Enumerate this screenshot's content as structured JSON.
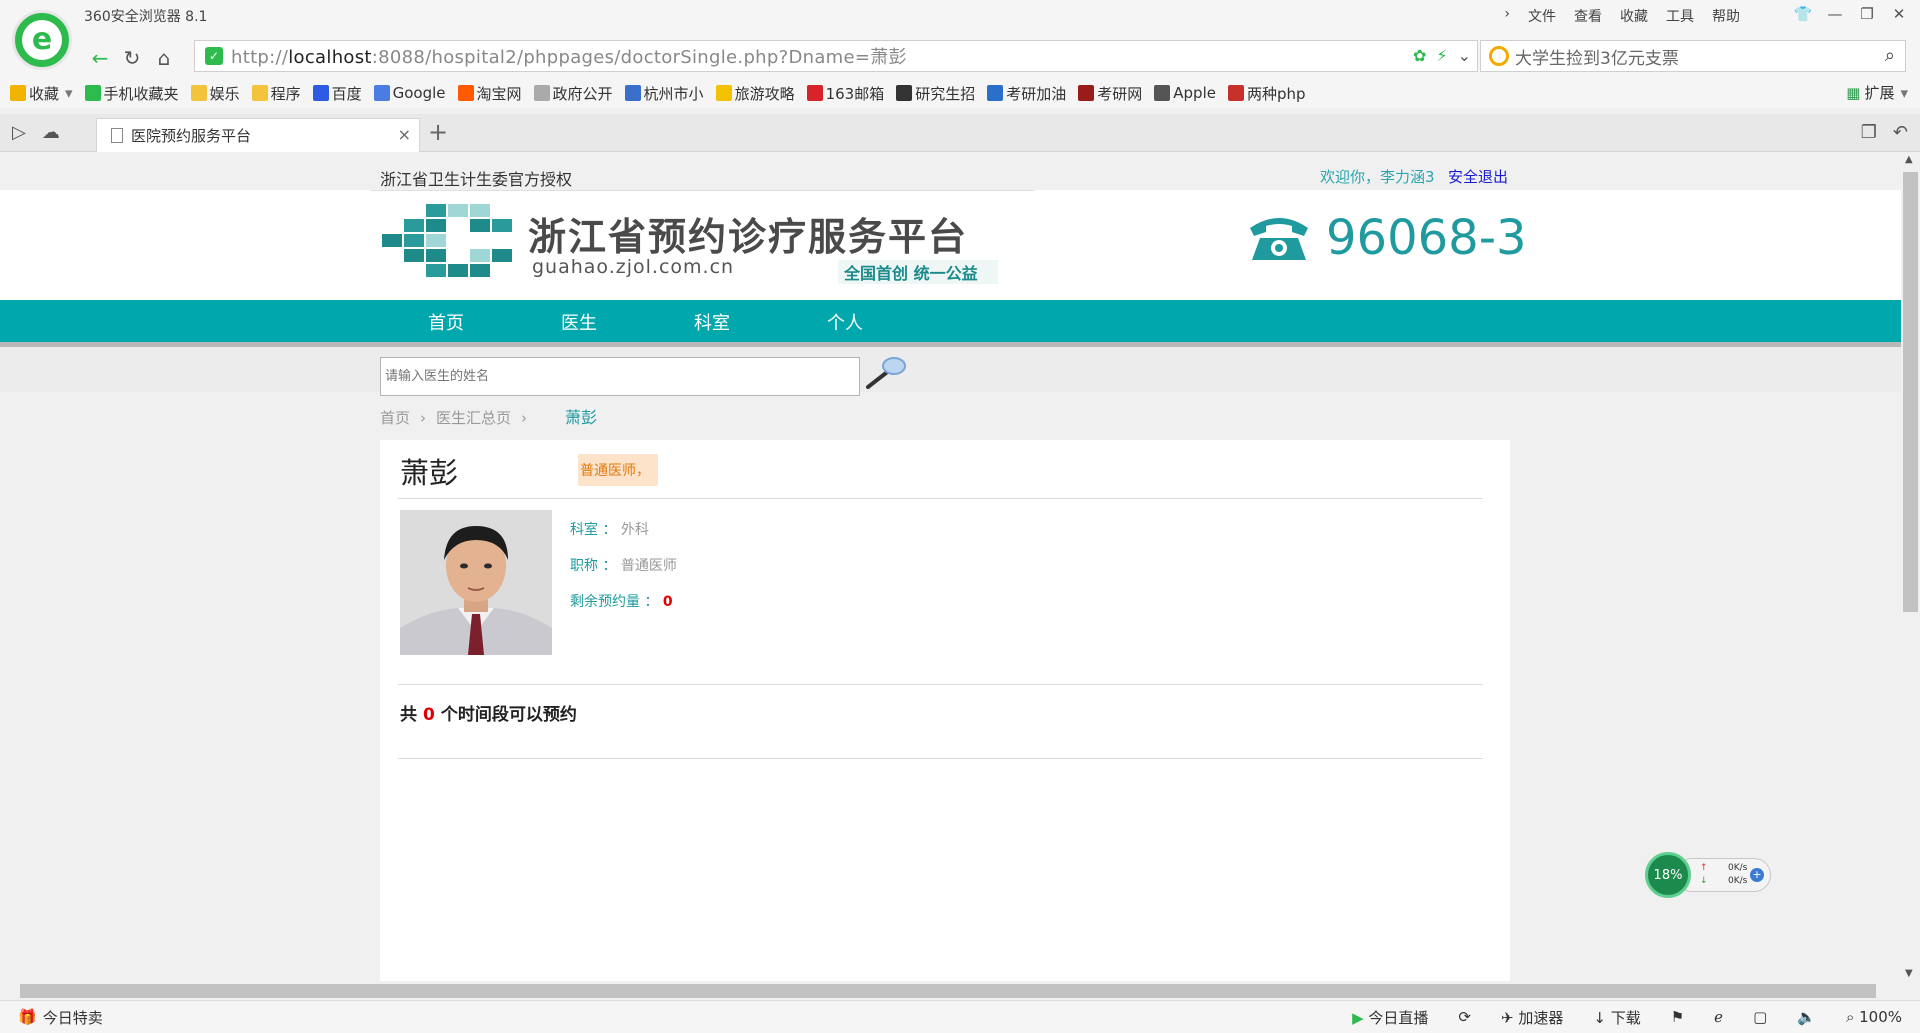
{
  "browser": {
    "app_title": "360安全浏览器 8.1",
    "menus": [
      "文件",
      "查看",
      "收藏",
      "工具",
      "帮助"
    ],
    "address_host": "localhost",
    "address_prefix": "http://",
    "address_rest": ":8088/hospital2/phppages/doctorSingle.php?Dname=萧彭",
    "search_value": "大学生捡到3亿元支票",
    "bookmarks": [
      {
        "label": "收藏",
        "icon": "star-icon",
        "color": "#f2b300"
      },
      {
        "label": "手机收藏夹",
        "icon": "phone-icon",
        "color": "#2ebb4e"
      },
      {
        "label": "娱乐",
        "icon": "folder-icon",
        "color": "#f3c33b"
      },
      {
        "label": "程序",
        "icon": "folder-icon",
        "color": "#f3c33b"
      },
      {
        "label": "百度",
        "icon": "baidu-icon",
        "color": "#2d5be3"
      },
      {
        "label": "Google",
        "icon": "google-icon",
        "color": "#4a7de2"
      },
      {
        "label": "淘宝网",
        "icon": "taobao-icon",
        "color": "#ff5a00"
      },
      {
        "label": "政府公开",
        "icon": "page-icon",
        "color": "#aaaaaa"
      },
      {
        "label": "杭州市小",
        "icon": "globe-icon",
        "color": "#3a6fc9"
      },
      {
        "label": "旅游攻略",
        "icon": "mail-icon",
        "color": "#f2c200"
      },
      {
        "label": "163邮箱",
        "icon": "163-icon",
        "color": "#d8232a"
      },
      {
        "label": "研究生招",
        "icon": "cap-icon",
        "color": "#333333"
      },
      {
        "label": "考研加油",
        "icon": "k-icon",
        "color": "#2a6fc9"
      },
      {
        "label": "考研网",
        "icon": "book-icon",
        "color": "#9b1b1b"
      },
      {
        "label": "Apple",
        "icon": "apple-icon",
        "color": "#555555"
      },
      {
        "label": "两种php",
        "icon": "b-icon",
        "color": "#c8302b"
      }
    ],
    "extensions_label": "扩展",
    "tab_title": "医院预约服务平台",
    "status_left": "今日特卖",
    "status_items": [
      "今日直播",
      "加速器",
      "下载"
    ],
    "zoom": "100%"
  },
  "page": {
    "authorization": "浙江省卫生计生委官方授权",
    "welcome": "欢迎你，李力涵3",
    "logout": "安全退出",
    "brand_name": "浙江省预约诊疗服务平台",
    "brand_domain": "guahao.zjol.com.cn",
    "brand_slogan": "全国首创  统一公益",
    "hotline": "96068-3",
    "nav": [
      "首页",
      "医生",
      "科室",
      "个人"
    ],
    "search_placeholder": "请输入医生的姓名",
    "breadcrumb": [
      "首页",
      "医生汇总页"
    ],
    "breadcrumb_current": "萧彭",
    "doctor": {
      "name": "萧彭",
      "tag": "普通医师，",
      "dept_label": "科室 ：",
      "dept_value": "外科",
      "title_label": "职称 ：",
      "title_value": "普通医师",
      "remain_label": "剩余预约量 ：",
      "remain_value": "0"
    },
    "availability": {
      "prefix": "共",
      "count": "0",
      "suffix": "个时间段可以预约"
    }
  },
  "speed_widget": {
    "percent": "18%",
    "up": "0K/s",
    "down": "0K/s"
  },
  "colors": {
    "accent": "#00a7ad",
    "brand_teal": "#1f9a9e",
    "highlight_red": "#e00000",
    "tag_bg": "#fde3c9",
    "tag_text": "#e07a10"
  }
}
